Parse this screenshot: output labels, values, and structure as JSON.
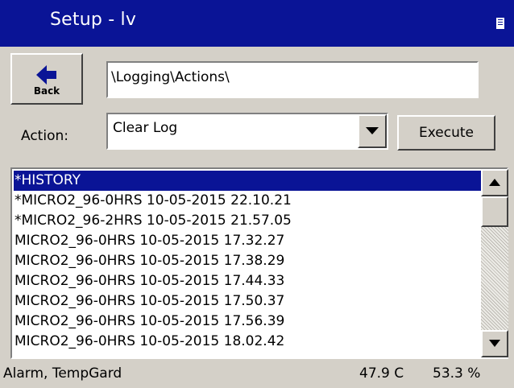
{
  "window": {
    "title": "Setup - lv",
    "title_icon": "window-menu-icon"
  },
  "back_button": {
    "label": "Back",
    "icon": "back-arrow-icon"
  },
  "path_field": {
    "value": "\\Logging\\Actions\\"
  },
  "action": {
    "label": "Action:",
    "selected": "Clear Log",
    "dropdown_icon": "chevron-down-icon"
  },
  "execute_button": {
    "label": "Execute"
  },
  "file_list": {
    "selected_index": 0,
    "items": [
      "*HISTORY",
      "*MICRO2_96-0HRS 10-05-2015 22.10.21",
      "*MICRO2_96-2HRS 10-05-2015 21.57.05",
      "MICRO2_96-0HRS 10-05-2015 17.32.27",
      "MICRO2_96-0HRS 10-05-2015 17.38.29",
      "MICRO2_96-0HRS 10-05-2015 17.44.33",
      "MICRO2_96-0HRS 10-05-2015 17.50.37",
      "MICRO2_96-0HRS 10-05-2015 17.56.39",
      "MICRO2_96-0HRS 10-05-2015 18.02.42"
    ],
    "scroll_position": 0.0
  },
  "status": {
    "app_name": "Alarm, TempGard",
    "temperature": "47.9 C",
    "humidity": "53.3 %"
  },
  "colors": {
    "titlebar": "#0a1496",
    "selection": "#0a1496",
    "face": "#d4d0c8"
  }
}
